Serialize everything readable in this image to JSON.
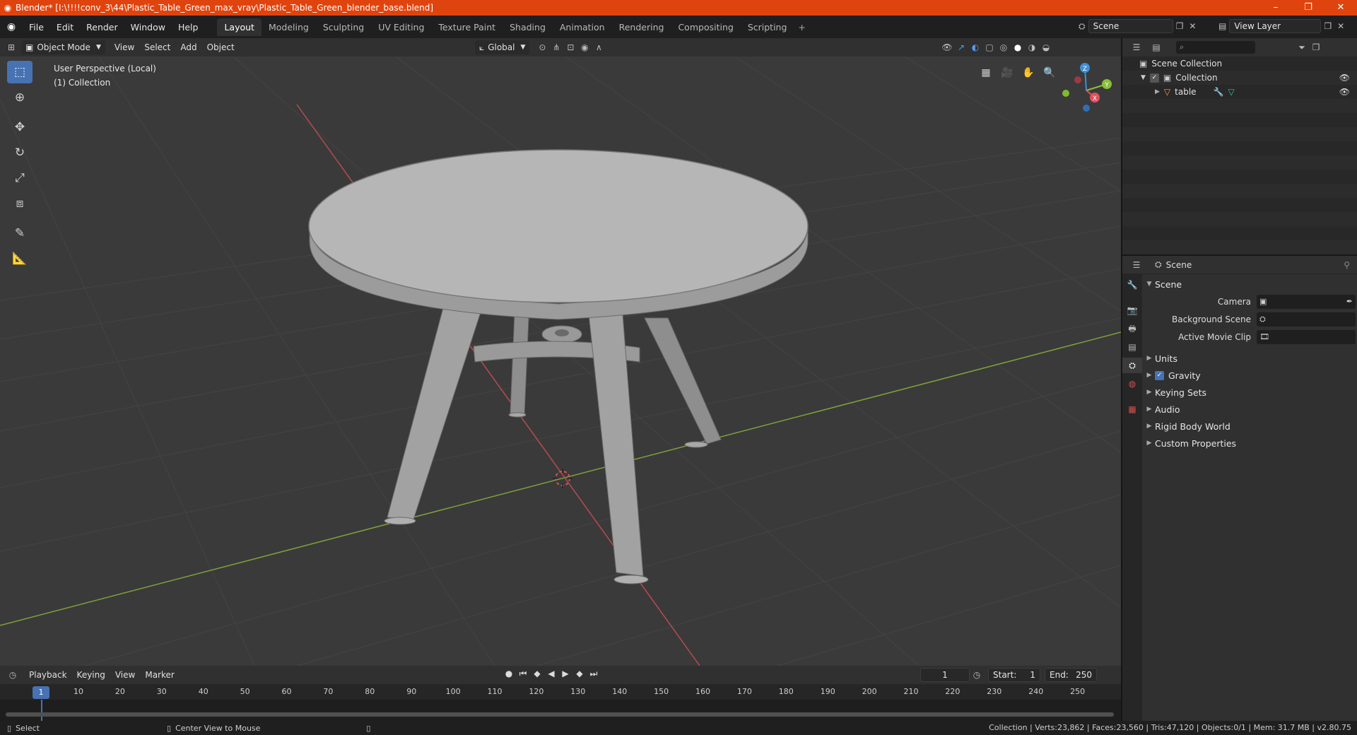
{
  "window": {
    "title": "Blender* [I:\\!!!!conv_3\\44\\Plastic_Table_Green_max_vray\\Plastic_Table_Green_blender_base.blend]",
    "minimize": "–",
    "maximize": "❐",
    "close": "✕"
  },
  "menu": [
    "File",
    "Edit",
    "Render",
    "Window",
    "Help"
  ],
  "workspaces": {
    "tabs": [
      "Layout",
      "Modeling",
      "Sculpting",
      "UV Editing",
      "Texture Paint",
      "Shading",
      "Animation",
      "Rendering",
      "Compositing",
      "Scripting"
    ],
    "active": "Layout",
    "add": "+"
  },
  "scene_selector": {
    "value": "Scene"
  },
  "view_layer_selector": {
    "value": "View Layer"
  },
  "viewport_header": {
    "mode": "Object Mode",
    "menus": [
      "View",
      "Select",
      "Add",
      "Object"
    ],
    "orientation": "Global"
  },
  "viewport": {
    "info_line1": "User Perspective (Local)",
    "info_line2": "(1) Collection",
    "gizmo": {
      "x": "X",
      "y": "Y",
      "z": "Z"
    }
  },
  "icons": {
    "toolbar": [
      "select-box-icon",
      "cursor-icon",
      "move-icon",
      "rotate-icon",
      "scale-icon",
      "transform-icon",
      "annotate-icon",
      "measure-icon"
    ],
    "nav": [
      "grid-icon",
      "camera-icon",
      "hand-icon",
      "zoom-icon"
    ]
  },
  "colors": {
    "accent": "#4772b3",
    "titlebar": "#e0440e",
    "axis_x": "#e05060",
    "axis_y": "#8ac039",
    "axis_z": "#3d8fd8"
  },
  "timeline": {
    "menus": [
      "Playback",
      "Keying",
      "View",
      "Marker"
    ],
    "current_frame": "1",
    "start_label": "Start:",
    "start_value": "1",
    "end_label": "End:",
    "end_value": "250",
    "ruler": [
      "1",
      "10",
      "20",
      "30",
      "40",
      "50",
      "60",
      "70",
      "80",
      "90",
      "100",
      "110",
      "120",
      "130",
      "140",
      "150",
      "160",
      "170",
      "180",
      "190",
      "200",
      "210",
      "220",
      "230",
      "240",
      "250"
    ]
  },
  "statusbar": {
    "left1": "Select",
    "left2": "Center View to Mouse",
    "right": "Collection | Verts:23,862 | Faces:23,560 | Tris:47,120 | Objects:0/1 | Mem: 31.7 MB | v2.80.75"
  },
  "outliner": {
    "root": "Scene Collection",
    "collection": "Collection",
    "object": "table"
  },
  "properties": {
    "context": "Scene",
    "panel": "Scene",
    "camera_label": "Camera",
    "background_label": "Background Scene",
    "movieclip_label": "Active Movie Clip",
    "sections": [
      "Units",
      "Gravity",
      "Keying Sets",
      "Audio",
      "Rigid Body World",
      "Custom Properties"
    ]
  }
}
